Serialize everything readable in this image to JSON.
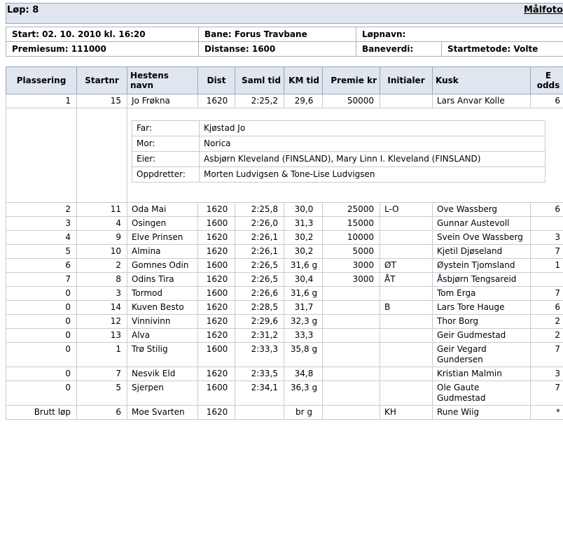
{
  "header": {
    "title": "Løp: 8",
    "link": "Målfoto"
  },
  "info": {
    "start": "Start: 02. 10. 2010 kl. 16:20",
    "bane": "Bane: Forus Travbane",
    "lopnavn": "Løpnavn:",
    "premiesum": "Premiesum: 111000",
    "distanse": "Distanse: 1600",
    "baneverdi": "Baneverdi:",
    "startmetode": "Startmetode: Volte"
  },
  "columns": [
    "Plassering",
    "Startnr",
    "Hestens navn",
    "Dist",
    "Saml tid",
    "KM tid",
    "Premie kr",
    "Initialer",
    "Kusk",
    "E odds"
  ],
  "detail": {
    "far_label": "Far:",
    "far": "Kjøstad Jo",
    "mor_label": "Mor:",
    "mor": "Norica",
    "eier_label": "Eier:",
    "eier": "Asbjørn Kleveland (FINSLAND), Mary Linn I. Kleveland (FINSLAND)",
    "oppdretter_label": "Oppdretter:",
    "oppdretter": "Morten Ludvigsen & Tone-Lise Ludvigsen"
  },
  "rows": [
    {
      "place": "1",
      "startnr": "15",
      "horse": "Jo Frøkna",
      "dist": "1620",
      "saml": "2:25,2",
      "km": "29,6",
      "premie": "50000",
      "init": "",
      "kusk": "Lars Anvar Kolle",
      "odds": "6"
    },
    {
      "place": "2",
      "startnr": "11",
      "horse": "Oda Mai",
      "dist": "1620",
      "saml": "2:25,8",
      "km": "30,0",
      "premie": "25000",
      "init": "L-O",
      "kusk": "Ove Wassberg",
      "odds": "6"
    },
    {
      "place": "3",
      "startnr": "4",
      "horse": "Osingen",
      "dist": "1600",
      "saml": "2:26,0",
      "km": "31,3",
      "premie": "15000",
      "init": "",
      "kusk": "Gunnar Austevoll",
      "odds": ""
    },
    {
      "place": "4",
      "startnr": "9",
      "horse": "Elve Prinsen",
      "dist": "1620",
      "saml": "2:26,1",
      "km": "30,2",
      "premie": "10000",
      "init": "",
      "kusk": "Svein Ove Wassberg",
      "odds": "3"
    },
    {
      "place": "5",
      "startnr": "10",
      "horse": "Almina",
      "dist": "1620",
      "saml": "2:26,1",
      "km": "30,2",
      "premie": "5000",
      "init": "",
      "kusk": "Kjetil Djøseland",
      "odds": "7"
    },
    {
      "place": "6",
      "startnr": "2",
      "horse": "Gomnes Odin",
      "dist": "1600",
      "saml": "2:26,5",
      "km": "31,6 g",
      "premie": "3000",
      "init": "ØT",
      "kusk": "Øystein Tjomsland",
      "odds": "1"
    },
    {
      "place": "7",
      "startnr": "8",
      "horse": "Odins Tira",
      "dist": "1620",
      "saml": "2:26,5",
      "km": "30,4",
      "premie": "3000",
      "init": "ÅT",
      "kusk": "Åsbjørn Tengsareid",
      "odds": ""
    },
    {
      "place": "0",
      "startnr": "3",
      "horse": "Tormod",
      "dist": "1600",
      "saml": "2:26,6",
      "km": "31,6 g",
      "premie": "",
      "init": "",
      "kusk": "Tom Erga",
      "odds": "7"
    },
    {
      "place": "0",
      "startnr": "14",
      "horse": "Kuven Besto",
      "dist": "1620",
      "saml": "2:28,5",
      "km": "31,7",
      "premie": "",
      "init": "B",
      "kusk": "Lars Tore Hauge",
      "odds": "6"
    },
    {
      "place": "0",
      "startnr": "12",
      "horse": "Vinnivinn",
      "dist": "1620",
      "saml": "2:29,6",
      "km": "32,3 g",
      "premie": "",
      "init": "",
      "kusk": "Thor Borg",
      "odds": "2"
    },
    {
      "place": "0",
      "startnr": "13",
      "horse": "Alva",
      "dist": "1620",
      "saml": "2:31,2",
      "km": "33,3",
      "premie": "",
      "init": "",
      "kusk": "Geir Gudmestad",
      "odds": "2"
    },
    {
      "place": "0",
      "startnr": "1",
      "horse": "Trø Stilig",
      "dist": "1600",
      "saml": "2:33,3",
      "km": "35,8 g",
      "premie": "",
      "init": "",
      "kusk": "Geir Vegard Gundersen",
      "odds": "7"
    },
    {
      "place": "0",
      "startnr": "7",
      "horse": "Nesvik Eld",
      "dist": "1620",
      "saml": "2:33,5",
      "km": "34,8",
      "premie": "",
      "init": "",
      "kusk": "Kristian Malmin",
      "odds": "3"
    },
    {
      "place": "0",
      "startnr": "5",
      "horse": "Sjerpen",
      "dist": "1600",
      "saml": "2:34,1",
      "km": "36,3 g",
      "premie": "",
      "init": "",
      "kusk": "Ole Gaute Gudmestad",
      "odds": "7"
    },
    {
      "place": "Brutt løp",
      "startnr": "6",
      "horse": "Moe Svarten",
      "dist": "1620",
      "saml": "",
      "km": "br g",
      "premie": "",
      "init": "KH",
      "kusk": "Rune Wiig",
      "odds": "*"
    }
  ]
}
